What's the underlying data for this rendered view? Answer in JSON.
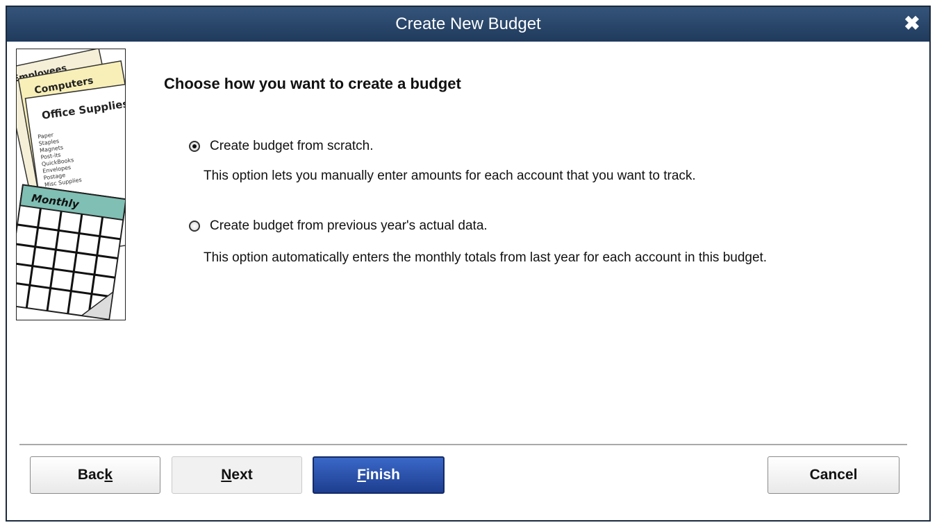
{
  "window": {
    "title": "Create New Budget"
  },
  "illustration": {
    "tab1": "Employees",
    "tab2": "Computers",
    "header": "Office Supplies",
    "lines": [
      "Paper",
      "Staples",
      "Magnets",
      "Post-its",
      "QuickBooks",
      "Envelopes",
      "Postage",
      "Misc Supplies"
    ],
    "calendar_label": "Monthly"
  },
  "heading": "Choose how you want to create a budget",
  "options": [
    {
      "label": "Create budget from scratch.",
      "selected": true,
      "description": "This option lets you manually enter amounts for each account that you want to track."
    },
    {
      "label": "Create budget from previous year's actual data.",
      "selected": false,
      "description": "This option automatically enters the monthly totals from last year for each account in this budget."
    }
  ],
  "buttons": {
    "back": {
      "pre": "Bac",
      "accel": "k",
      "post": ""
    },
    "next": {
      "pre": "",
      "accel": "N",
      "post": "ext"
    },
    "finish": {
      "pre": "",
      "accel": "F",
      "post": "inish"
    },
    "cancel": "Cancel"
  },
  "colors": {
    "titlebar": "#2a4768",
    "primary_button": "#2b52b0"
  }
}
